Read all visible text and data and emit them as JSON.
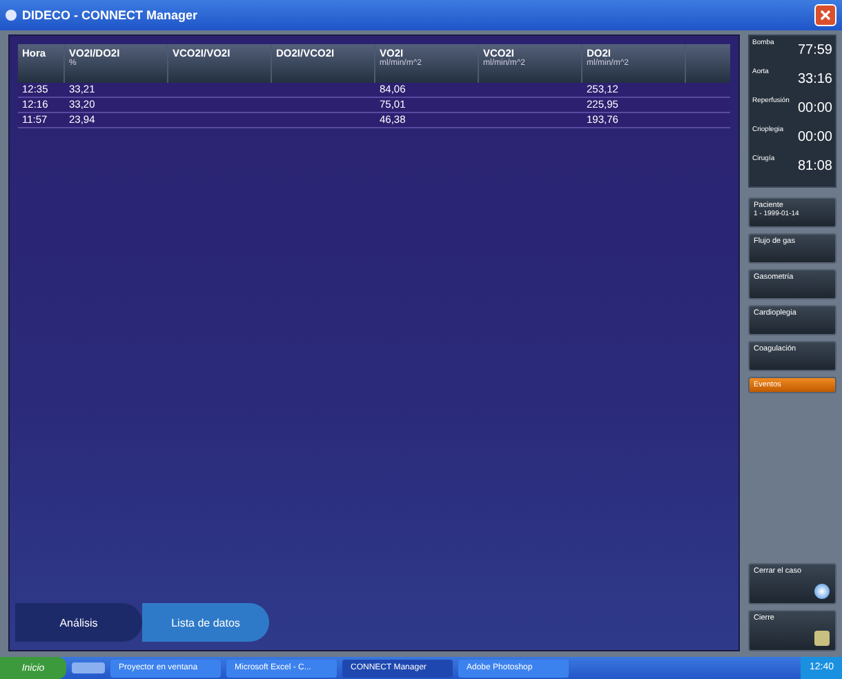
{
  "window": {
    "title": "DIDECO - CONNECT Manager"
  },
  "table": {
    "columns": [
      {
        "label": "Hora"
      },
      {
        "label": "VO2I/DO2I",
        "unit": "%"
      },
      {
        "label": "VCO2I/VO2I"
      },
      {
        "label": "DO2I/VCO2I"
      },
      {
        "label": "VO2I",
        "unit": "ml/min/m^2"
      },
      {
        "label": "VCO2I",
        "unit": "ml/min/m^2"
      },
      {
        "label": "DO2I",
        "unit": "ml/min/m^2"
      }
    ],
    "rows": [
      [
        "12:35",
        "33,21",
        "",
        "",
        "84,06",
        "",
        "253,12"
      ],
      [
        "12:16",
        "33,20",
        "",
        "",
        "75,01",
        "",
        "225,95"
      ],
      [
        "11:57",
        "23,94",
        "",
        "",
        "46,38",
        "",
        "193,76"
      ]
    ]
  },
  "timers": [
    {
      "label": "Bomba",
      "value": "77:59"
    },
    {
      "label": "Aorta",
      "value": "33:16"
    },
    {
      "label": "Reperfusión",
      "value": "00:00"
    },
    {
      "label": "Crioplegia",
      "value": "00:00"
    },
    {
      "label": "Cirugía",
      "value": "81:08"
    }
  ],
  "side_buttons": [
    {
      "label": "Paciente",
      "detail": "1 - 1999-01-14",
      "selected": false
    },
    {
      "label": "Flujo de gas",
      "selected": false
    },
    {
      "label": "Gasometría",
      "selected": false
    },
    {
      "label": "Cardioplegia",
      "selected": false
    },
    {
      "label": "Coagulación",
      "selected": false
    },
    {
      "label": "Eventos",
      "selected": true
    }
  ],
  "bottom_buttons": [
    {
      "label": "Cerrar el caso",
      "kind": "close-case"
    },
    {
      "label": "Cierre",
      "kind": "exit"
    }
  ],
  "tabs": [
    {
      "label": "Análisis",
      "selected": false
    },
    {
      "label": "Lista de datos",
      "selected": true
    }
  ],
  "taskbar": {
    "start": "Inicio",
    "items": [
      {
        "label": "Proyector en ventana",
        "selected": false
      },
      {
        "label": "Microsoft Excel - C...",
        "selected": false
      },
      {
        "label": "CONNECT Manager",
        "selected": true
      },
      {
        "label": "Adobe Photoshop",
        "selected": false
      }
    ],
    "clock": "12:40"
  }
}
